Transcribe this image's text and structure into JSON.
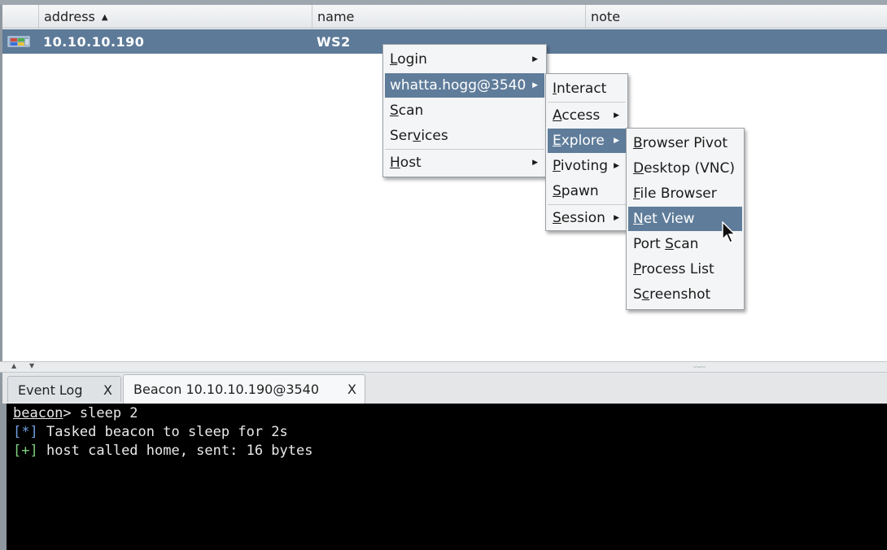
{
  "table": {
    "columns": [
      "address",
      "name",
      "note"
    ],
    "sort_indicator": "▲",
    "rows": [
      {
        "icon": "windows-host-icon",
        "address": "10.10.10.190",
        "name": "WS2",
        "note": ""
      }
    ]
  },
  "context_menu": {
    "items": [
      {
        "label_pre": "",
        "label_u": "L",
        "label_post": "ogin",
        "submenu": true
      },
      {
        "label": "whatta.hogg@3540",
        "submenu": true,
        "selected": true
      },
      {
        "label_pre": "",
        "label_u": "S",
        "label_post": "can",
        "submenu": false
      },
      {
        "label_pre": "Ser",
        "label_u": "v",
        "label_post": "ices",
        "submenu": false
      },
      {
        "label_pre": "",
        "label_u": "H",
        "label_post": "ost",
        "submenu": true
      }
    ]
  },
  "session_menu": {
    "items": [
      {
        "label_pre": "",
        "label_u": "I",
        "label_post": "nteract",
        "submenu": false
      },
      {
        "label_pre": "",
        "label_u": "A",
        "label_post": "ccess",
        "submenu": true
      },
      {
        "label_pre": "",
        "label_u": "E",
        "label_post": "xplore",
        "submenu": true,
        "selected": true
      },
      {
        "label_pre": "",
        "label_u": "P",
        "label_post": "ivoting",
        "submenu": true
      },
      {
        "label_pre": "",
        "label_u": "S",
        "label_post": "pawn",
        "submenu": false
      },
      {
        "label_pre": "",
        "label_u": "S",
        "label_post": "ession",
        "submenu": true
      }
    ]
  },
  "explore_menu": {
    "items": [
      {
        "label_pre": "",
        "label_u": "B",
        "label_post": "rowser Pivot"
      },
      {
        "label_pre": "",
        "label_u": "D",
        "label_post": "esktop (VNC)"
      },
      {
        "label_pre": "",
        "label_u": "F",
        "label_post": "ile Browser"
      },
      {
        "label_pre": "",
        "label_u": "N",
        "label_post": "et View",
        "selected": true
      },
      {
        "label_pre": "Port ",
        "label_u": "S",
        "label_post": "can"
      },
      {
        "label_pre": "",
        "label_u": "P",
        "label_post": "rocess List"
      },
      {
        "label_pre": "S",
        "label_u": "c",
        "label_post": "reenshot"
      }
    ]
  },
  "tabs": [
    {
      "label": "Event Log",
      "close": "X"
    },
    {
      "label": "Beacon 10.10.10.190@3540",
      "close": "X",
      "active": true
    }
  ],
  "console": {
    "prompt": "beacon",
    "command": "> sleep 2",
    "lines": [
      {
        "tag": "[*]",
        "text": " Tasked beacon to sleep for 2s"
      },
      {
        "tag": "[+]",
        "text": " host called home, sent: 16 bytes"
      }
    ]
  },
  "colors": {
    "selection": "#5f7c9a",
    "row_selected": "#5d7a98",
    "console_bg": "#000000",
    "info_tag": "#6f9fe0",
    "success_tag": "#7ed07e"
  }
}
